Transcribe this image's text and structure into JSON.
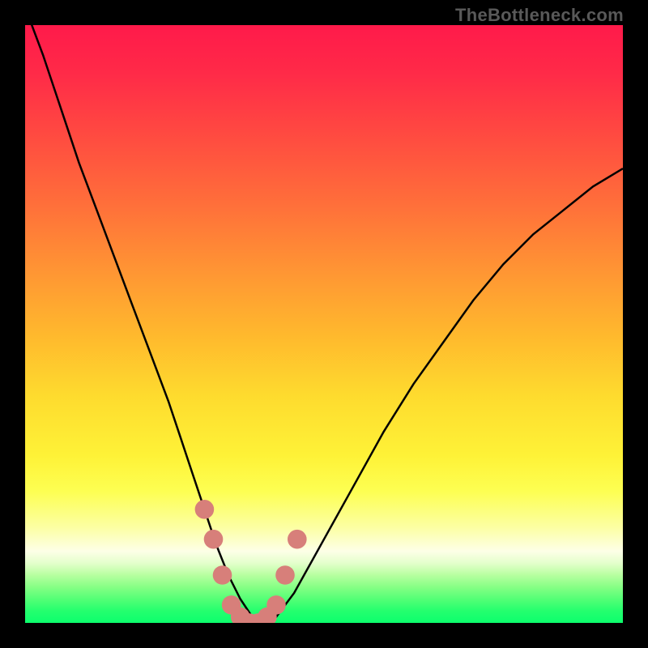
{
  "attribution": "TheBottleneck.com",
  "chart_data": {
    "type": "line",
    "title": "",
    "xlabel": "",
    "ylabel": "",
    "xlim": [
      0,
      100
    ],
    "ylim": [
      0,
      100
    ],
    "background": {
      "type": "vertical-gradient",
      "stops": [
        {
          "pos": 0,
          "color": "#ff1a4a"
        },
        {
          "pos": 50,
          "color": "#ffb92d"
        },
        {
          "pos": 78,
          "color": "#fdff52"
        },
        {
          "pos": 100,
          "color": "#0cff6d"
        }
      ],
      "meaning": "red (top) = high bottleneck, green (bottom) = no bottleneck"
    },
    "series": [
      {
        "name": "bottleneck-curve",
        "color": "#000000",
        "x": [
          0,
          3,
          6,
          9,
          12,
          15,
          18,
          21,
          24,
          26,
          28,
          30,
          32,
          34,
          36,
          38,
          40,
          42,
          45,
          50,
          55,
          60,
          65,
          70,
          75,
          80,
          85,
          90,
          95,
          100
        ],
        "y": [
          103,
          95,
          86,
          77,
          69,
          61,
          53,
          45,
          37,
          31,
          25,
          19,
          13,
          8,
          4,
          1,
          0,
          1,
          5,
          14,
          23,
          32,
          40,
          47,
          54,
          60,
          65,
          69,
          73,
          76
        ]
      }
    ],
    "markers": {
      "name": "curve-samples",
      "color": "#d77f7a",
      "radius_pct": 1.6,
      "points": [
        {
          "x": 30.0,
          "y": 19
        },
        {
          "x": 31.5,
          "y": 14
        },
        {
          "x": 33.0,
          "y": 8
        },
        {
          "x": 34.5,
          "y": 3
        },
        {
          "x": 36.0,
          "y": 1
        },
        {
          "x": 37.5,
          "y": 0
        },
        {
          "x": 39.0,
          "y": 0
        },
        {
          "x": 40.5,
          "y": 1
        },
        {
          "x": 42.0,
          "y": 3
        },
        {
          "x": 43.5,
          "y": 8
        },
        {
          "x": 45.5,
          "y": 14
        }
      ]
    }
  }
}
